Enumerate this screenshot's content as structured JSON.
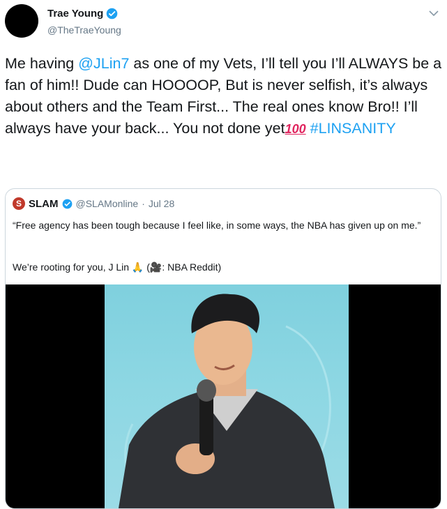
{
  "author": {
    "name": "Trae Young",
    "handle": "@TheTraeYoung"
  },
  "tweet": {
    "part1": "Me having ",
    "mention": "@JLin7",
    "part2": " as one of my Vets, I’ll tell you I’ll ALWAYS be a fan of him!! Dude can HOOOOP, But is never selfish, it’s always about others and the Team First... The real ones know Bro!! I’ll always have your back... You not done yet",
    "emoji": "100",
    "hashtag": "#LINSANITY"
  },
  "quoted": {
    "name": "SLAM",
    "logo_letter": "S",
    "handle": "@SLAMonline",
    "separator": " · ",
    "date": "Jul 28",
    "text1": "“Free agency has been tough because I feel like, in some ways, the NBA has given up on me.”",
    "text2": "We’re rooting for you, J Lin 🙏 (🎥: NBA Reddit)"
  },
  "colors": {
    "link": "#1da1f2",
    "verified": "#1da1f2",
    "stage": "#8dd7e3",
    "slam_logo": "#c0392b"
  },
  "icons": [
    "verified-icon",
    "chevron-down-icon",
    "praying-hands-icon",
    "camera-icon"
  ]
}
